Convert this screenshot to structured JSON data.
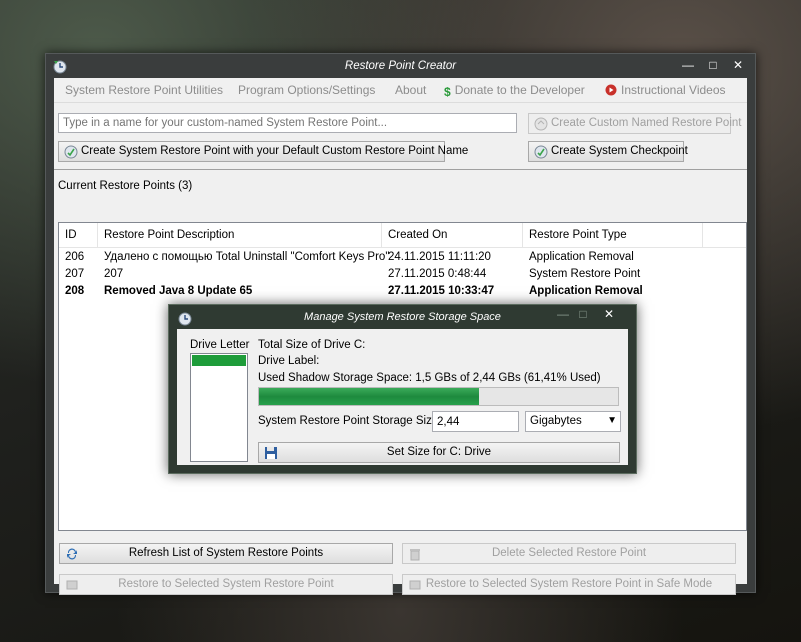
{
  "window": {
    "title": "Restore Point Creator"
  },
  "menu": {
    "utilities": "System Restore Point Utilities",
    "options": "Program Options/Settings",
    "about": "About",
    "donate": "Donate to the Developer",
    "videos": "Instructional Videos"
  },
  "custom": {
    "placeholder": "Type in a name for your custom-named System Restore Point...",
    "create_custom_named": "Create Custom Named Restore Point",
    "create_default": "Create System Restore Point with your Default Custom Restore Point Name",
    "create_checkpoint": "Create System Checkpoint"
  },
  "list": {
    "label": "Current Restore Points (3)",
    "columns": [
      "ID",
      "Restore Point Description",
      "Created On",
      "Restore Point Type"
    ],
    "rows": [
      {
        "id": "206",
        "description": "Удалено с помощью Total Uninstall \"Comfort Keys Pro\"",
        "created": "24.11.2015 11:11:20",
        "type": "Application Removal"
      },
      {
        "id": "207",
        "description": "207",
        "created": "27.11.2015 0:48:44",
        "type": "System Restore Point"
      },
      {
        "id": "208",
        "description": "Removed Java 8 Update 65",
        "created": "27.11.2015 10:33:47",
        "type": "Application Removal"
      }
    ]
  },
  "actions": {
    "refresh": "Refresh List of System Restore Points",
    "delete": "Delete Selected Restore Point",
    "restore": "Restore to Selected System Restore Point",
    "restore_safe": "Restore to Selected System Restore Point in Safe Mode"
  },
  "dialog": {
    "title": "Manage System Restore Storage Space",
    "drive_letter_label": "Drive Letter",
    "total_size": "Total Size of Drive C:",
    "drive_label": "Drive Label:",
    "used_space": "Used Shadow Storage Space: 1,5 GBs of 2,44 GBs (61,41% Used)",
    "used_fraction": 0.6141,
    "storage_size_label": "System Restore Point Storage Size:",
    "storage_size_value": "2,44",
    "unit": "Gigabytes",
    "set_size": "Set Size for C: Drive"
  }
}
